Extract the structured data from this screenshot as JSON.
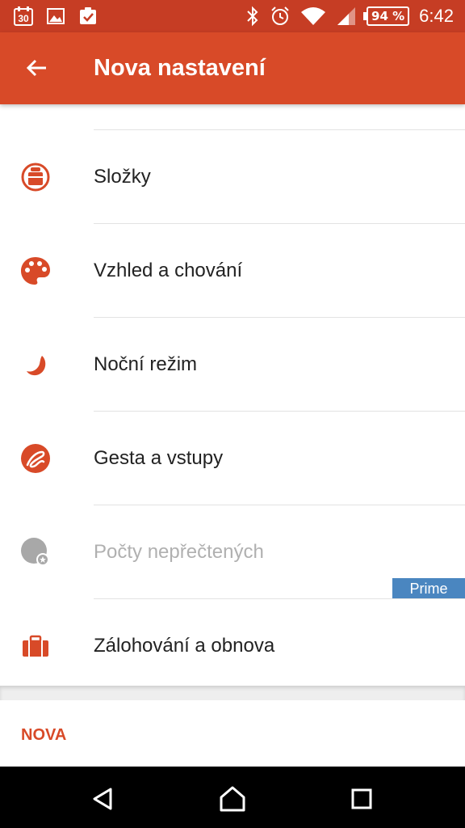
{
  "status_bar": {
    "calendar_day": "30",
    "battery": "94 %",
    "time": "6:42",
    "icons": [
      "calendar-icon",
      "image-icon",
      "clipboard-check-icon",
      "bluetooth-icon",
      "alarm-icon",
      "wifi-icon",
      "signal-icon",
      "battery-icon"
    ]
  },
  "app_bar": {
    "title": "Nova nastavení",
    "back_icon": "arrow-back-icon",
    "color": "#d84a28"
  },
  "settings": [
    {
      "label": "Složky",
      "icon": "folder-drawer-icon"
    },
    {
      "label": "Vzhled a chování",
      "icon": "palette-icon"
    },
    {
      "label": "Noční režim",
      "icon": "moon-icon"
    },
    {
      "label": "Gesta a vstupy",
      "icon": "gesture-icon"
    },
    {
      "label": "Počty nepřečtených",
      "icon": "unread-badge-icon",
      "disabled": true,
      "badge": "Prime"
    },
    {
      "label": "Zálohování a obnova",
      "icon": "briefcase-icon"
    }
  ],
  "footer": {
    "label": "NOVA"
  },
  "nav_bar": {
    "icons": [
      "back-triangle-icon",
      "home-icon",
      "recents-icon"
    ]
  },
  "colors": {
    "accent": "#d84a28",
    "status_bar": "#c63d24",
    "prime_badge": "#4a86c0",
    "disabled_text": "#b0b0b0"
  }
}
